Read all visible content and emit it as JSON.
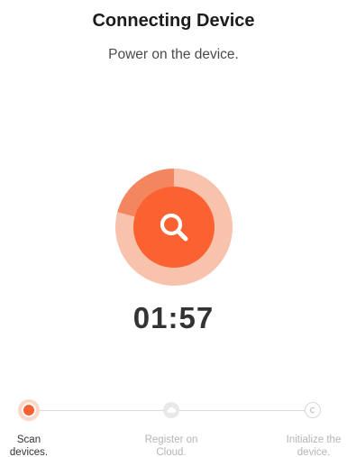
{
  "header": {
    "title": "Connecting Device",
    "subtitle": "Power on the device."
  },
  "scan": {
    "timer": "01:57",
    "icon": "search-icon",
    "accent_color": "#fb6131",
    "ring_color": "#f8c2ad"
  },
  "steps": [
    {
      "label_line1": "Scan",
      "label_line2": "devices.",
      "state": "active",
      "icon": "active-dot-icon"
    },
    {
      "label_line1": "Register on",
      "label_line2": "Cloud.",
      "state": "pending",
      "icon": "cloud-icon"
    },
    {
      "label_line1": "Initialize the",
      "label_line2": "device.",
      "state": "pending",
      "icon": "copyright-icon"
    }
  ]
}
